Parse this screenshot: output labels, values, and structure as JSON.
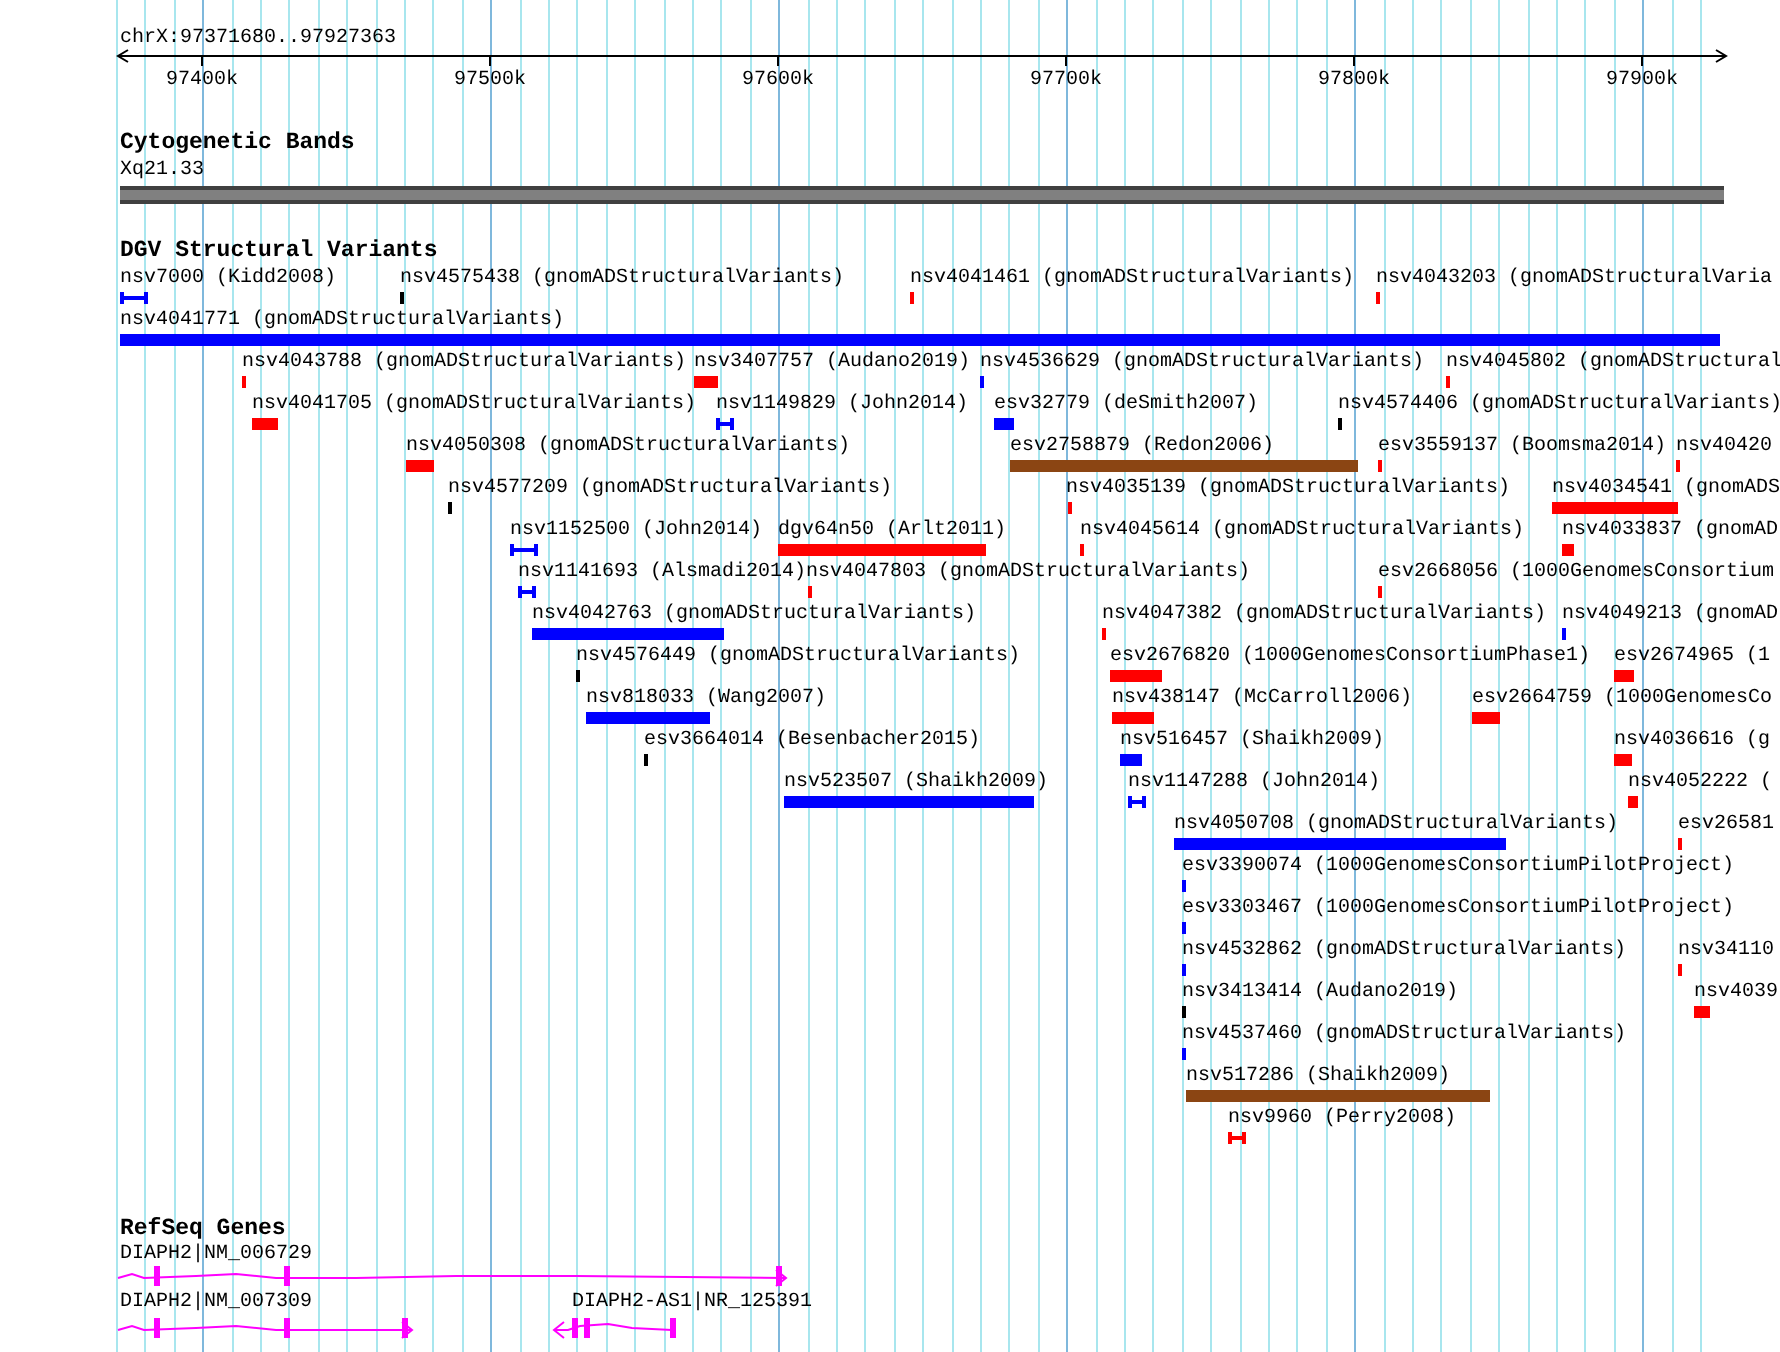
{
  "location": "chrX:97371680..97927363",
  "ruler": {
    "ticks": [
      "97400k",
      "97500k",
      "97600k",
      "97700k",
      "97800k",
      "97900k"
    ]
  },
  "cytobands": {
    "title": "Cytogenetic Bands",
    "band": "Xq21.33"
  },
  "variants": {
    "title": "DGV Structural Variants",
    "features": [
      {
        "label": "nsv7000 (Kidd2008)",
        "color": "#0000ff",
        "kind": "interval"
      },
      {
        "label": "nsv4575438 (gnomADStructuralVariants)",
        "color": "#000000",
        "kind": "block"
      },
      {
        "label": "nsv4041461 (gnomADStructuralVariants)",
        "color": "#ff0000",
        "kind": "block"
      },
      {
        "label": "nsv4043203 (gnomADStructuralVaria",
        "color": "#ff0000",
        "kind": "block"
      },
      {
        "label": "nsv4041771 (gnomADStructuralVariants)",
        "color": "#0000ff",
        "kind": "block"
      },
      {
        "label": "nsv4043788 (gnomADStructuralVariants)",
        "color": "#ff0000",
        "kind": "block"
      },
      {
        "label": "nsv3407757 (Audano2019)",
        "color": "#ff0000",
        "kind": "block"
      },
      {
        "label": "nsv4536629 (gnomADStructuralVariants)",
        "color": "#0000ff",
        "kind": "block"
      },
      {
        "label": "nsv4045802 (gnomADStructural",
        "color": "#ff0000",
        "kind": "block"
      },
      {
        "label": "nsv4041705 (gnomADStructuralVariants)",
        "color": "#ff0000",
        "kind": "block"
      },
      {
        "label": "nsv1149829 (John2014)",
        "color": "#0000ff",
        "kind": "interval"
      },
      {
        "label": "esv32779 (deSmith2007)",
        "color": "#0000ff",
        "kind": "block"
      },
      {
        "label": "nsv4574406 (gnomADStructuralVariants)",
        "color": "#000000",
        "kind": "block"
      },
      {
        "label": "nsv4050308 (gnomADStructuralVariants)",
        "color": "#ff0000",
        "kind": "block"
      },
      {
        "label": "esv2758879 (Redon2006)",
        "color": "#8b4513",
        "kind": "block"
      },
      {
        "label": "esv3559137 (Boomsma2014)",
        "color": "#ff0000",
        "kind": "block"
      },
      {
        "label": "nsv40420",
        "color": "#ff0000",
        "kind": "block"
      },
      {
        "label": "nsv4577209 (gnomADStructuralVariants)",
        "color": "#000000",
        "kind": "block"
      },
      {
        "label": "nsv4035139 (gnomADStructuralVariants)",
        "color": "#ff0000",
        "kind": "block"
      },
      {
        "label": "nsv4034541 (gnomADS",
        "color": "#ff0000",
        "kind": "block"
      },
      {
        "label": "nsv1152500 (John2014)",
        "color": "#0000ff",
        "kind": "interval"
      },
      {
        "label": "dgv64n50 (Arlt2011)",
        "color": "#ff0000",
        "kind": "block"
      },
      {
        "label": "nsv4045614 (gnomADStructuralVariants)",
        "color": "#ff0000",
        "kind": "block"
      },
      {
        "label": "nsv4033837 (gnomAD",
        "color": "#ff0000",
        "kind": "block"
      },
      {
        "label": "nsv1141693 (Alsmadi2014)",
        "color": "#0000ff",
        "kind": "interval"
      },
      {
        "label": "nsv4047803 (gnomADStructuralVariants)",
        "color": "#ff0000",
        "kind": "block"
      },
      {
        "label": "esv2668056 (1000GenomesConsortium",
        "color": "#ff0000",
        "kind": "block"
      },
      {
        "label": "nsv4042763 (gnomADStructuralVariants)",
        "color": "#0000ff",
        "kind": "block"
      },
      {
        "label": "nsv4047382 (gnomADStructuralVariants)",
        "color": "#ff0000",
        "kind": "block"
      },
      {
        "label": "nsv4049213 (gnomAD",
        "color": "#0000ff",
        "kind": "block"
      },
      {
        "label": "nsv4576449 (gnomADStructuralVariants)",
        "color": "#000000",
        "kind": "block"
      },
      {
        "label": "esv2676820 (1000GenomesConsortiumPhase1)",
        "color": "#ff0000",
        "kind": "block"
      },
      {
        "label": "esv2674965 (1",
        "color": "#ff0000",
        "kind": "block"
      },
      {
        "label": "nsv818033 (Wang2007)",
        "color": "#0000ff",
        "kind": "block"
      },
      {
        "label": "nsv438147 (McCarroll2006)",
        "color": "#ff0000",
        "kind": "block"
      },
      {
        "label": "esv2664759 (1000GenomesCo",
        "color": "#ff0000",
        "kind": "block"
      },
      {
        "label": "esv3664014 (Besenbacher2015)",
        "color": "#000000",
        "kind": "block"
      },
      {
        "label": "nsv516457 (Shaikh2009)",
        "color": "#0000ff",
        "kind": "block"
      },
      {
        "label": "nsv4036616 (g",
        "color": "#ff0000",
        "kind": "block"
      },
      {
        "label": "nsv523507 (Shaikh2009)",
        "color": "#0000ff",
        "kind": "block"
      },
      {
        "label": "nsv1147288 (John2014)",
        "color": "#0000ff",
        "kind": "interval"
      },
      {
        "label": "nsv4052222 (",
        "color": "#ff0000",
        "kind": "block"
      },
      {
        "label": "nsv4050708 (gnomADStructuralVariants)",
        "color": "#0000ff",
        "kind": "block"
      },
      {
        "label": "esv26581",
        "color": "#ff0000",
        "kind": "block"
      },
      {
        "label": "esv3390074 (1000GenomesConsortiumPilotProject)",
        "color": "#0000ff",
        "kind": "block"
      },
      {
        "label": "esv3303467 (1000GenomesConsortiumPilotProject)",
        "color": "#0000ff",
        "kind": "block"
      },
      {
        "label": "nsv4532862 (gnomADStructuralVariants)",
        "color": "#0000ff",
        "kind": "block"
      },
      {
        "label": "nsv34110",
        "color": "#ff0000",
        "kind": "block"
      },
      {
        "label": "nsv3413414 (Audano2019)",
        "color": "#000000",
        "kind": "block"
      },
      {
        "label": "nsv4039",
        "color": "#ff0000",
        "kind": "block"
      },
      {
        "label": "nsv4537460 (gnomADStructuralVariants)",
        "color": "#0000ff",
        "kind": "block"
      },
      {
        "label": "nsv517286 (Shaikh2009)",
        "color": "#8b4513",
        "kind": "block"
      },
      {
        "label": "nsv9960 (Perry2008)",
        "color": "#ff0000",
        "kind": "interval"
      }
    ]
  },
  "genes": {
    "title": "RefSeq Genes",
    "features": [
      {
        "label": "DIAPH2|NM_006729",
        "kind": "forward"
      },
      {
        "label": "DIAPH2|NM_007309",
        "kind": "forward"
      },
      {
        "label": "DIAPH2-AS1|NR_125391",
        "kind": "reverse"
      }
    ]
  }
}
